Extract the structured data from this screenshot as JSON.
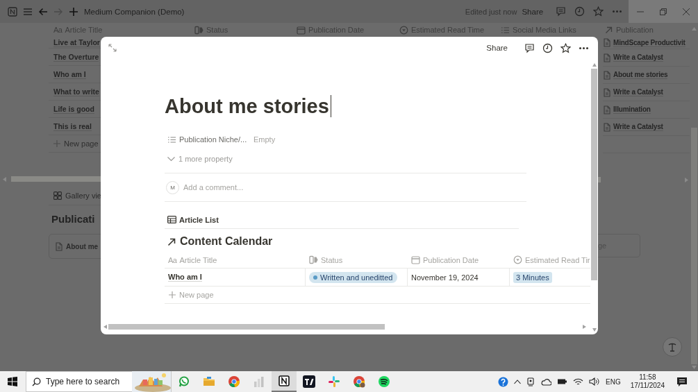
{
  "app_bar": {
    "title": "Medium Companion (Demo)",
    "edit_status": "Edited just now",
    "share": "Share"
  },
  "background_table": {
    "columns": [
      {
        "kind": "title",
        "glyph": "Aa",
        "label": "Article Title"
      },
      {
        "kind": "status",
        "label": "Status"
      },
      {
        "kind": "date",
        "label": "Publication Date"
      },
      {
        "kind": "select",
        "label": "Estimated Read Time"
      },
      {
        "kind": "multi",
        "label": "Social Media Links"
      },
      {
        "kind": "relation",
        "label": "Publication"
      }
    ],
    "titles": [
      "Live at Taylor",
      "The Overture",
      "Who am I",
      "What to write",
      "Life is good",
      "This is real"
    ],
    "new_page": "New page",
    "publications": [
      "MindScape Productivit",
      "Write a Catalyst",
      "About me stories",
      "Write a Catalyst",
      "Illumination",
      "Write a Catalyst"
    ]
  },
  "gallery": {
    "view": "Gallery vie",
    "heading": "Publicati",
    "card": "About me",
    "right_card": "ge"
  },
  "modal": {
    "share": "Share",
    "title": "About me stories",
    "properties": [
      {
        "name": "Publication Niche/...",
        "placeholder": "Empty"
      }
    ],
    "more": "1 more property",
    "comment": {
      "avatar": "M",
      "placeholder": "Add a comment..."
    },
    "linked_view": "Article List",
    "database": {
      "title": "Content Calendar",
      "columns": [
        {
          "kind": "title",
          "glyph": "Aa",
          "label": "Article Title"
        },
        {
          "kind": "status",
          "label": "Status"
        },
        {
          "kind": "date",
          "label": "Publication Date"
        },
        {
          "kind": "select",
          "label": "Estimated Read Tir"
        }
      ],
      "rows": [
        {
          "title": "Who am I",
          "status": {
            "label": "Written and uneditted",
            "color": "#5a9bc6"
          },
          "date": "November 19, 2024",
          "read_time": "3 Minutes"
        }
      ],
      "new_page": "New page"
    }
  },
  "taskbar": {
    "search_placeholder": "Type here to search",
    "apps": [
      {
        "kind": "chat",
        "selected": false
      },
      {
        "kind": "folder",
        "selected": false
      },
      {
        "kind": "browser",
        "selected": false
      },
      {
        "kind": "bars",
        "selected": false
      },
      {
        "kind": "cube",
        "selected": true
      },
      {
        "kind": "chartapp",
        "selected": false
      },
      {
        "kind": "hash",
        "selected": false
      },
      {
        "kind": "browser2",
        "selected": false
      },
      {
        "kind": "music",
        "selected": false
      }
    ],
    "language": "ENG",
    "time": "11:58",
    "date": "17/11/2024"
  }
}
